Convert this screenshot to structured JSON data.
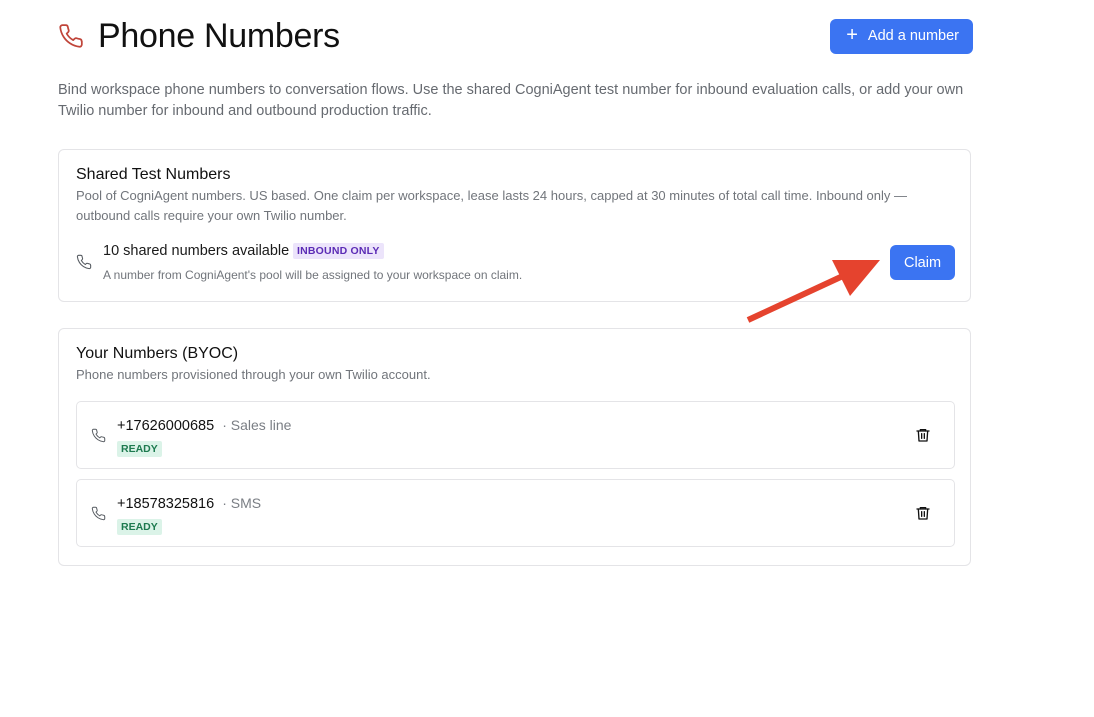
{
  "header": {
    "title": "Phone Numbers",
    "icon": "phone-icon",
    "add_button_label": "Add a number"
  },
  "description": "Bind workspace phone numbers to conversation flows. Use the shared CogniAgent test number for inbound evaluation calls, or add your own Twilio number for inbound and outbound production traffic.",
  "shared": {
    "title": "Shared Test Numbers",
    "subtitle": "Pool of CogniAgent numbers. US based. One claim per workspace, lease lasts 24 hours, capped at 30 minutes of total call time. Inbound only — outbound calls require your own Twilio number.",
    "available_text": "10 shared numbers available",
    "badge": "INBOUND ONLY",
    "note": "A number from CogniAgent's pool will be assigned to your workspace on claim.",
    "claim_label": "Claim"
  },
  "byoc": {
    "title": "Your Numbers (BYOC)",
    "subtitle": "Phone numbers provisioned through your own Twilio account.",
    "numbers": [
      {
        "number": "+17626000685",
        "label": "· Sales line",
        "status": "READY"
      },
      {
        "number": "+18578325816",
        "label": "· SMS",
        "status": "READY"
      }
    ]
  },
  "colors": {
    "accent": "#3b74f2",
    "title_icon": "#c0453a",
    "annotation_arrow": "#e5432e",
    "inbound_badge_bg": "#ece4fb",
    "inbound_badge_fg": "#5b2bb5",
    "ready_badge_bg": "#dbf3e8",
    "ready_badge_fg": "#1d7a4f"
  }
}
